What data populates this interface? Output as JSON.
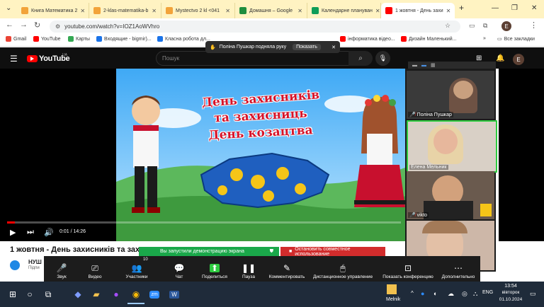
{
  "browser": {
    "tabs": [
      {
        "title": "Книга Математика 2",
        "color": "#f2a33a"
      },
      {
        "title": "2-klas-matematika-b",
        "color": "#f2a33a"
      },
      {
        "title": "Mystectvo 2 kl <041",
        "color": "#f2a33a"
      },
      {
        "title": "Домашня – Google",
        "color": "#1e8e3e"
      },
      {
        "title": "Календарне плануван",
        "color": "#0f9d58"
      },
      {
        "title": "1 жовтня - День захи",
        "color": "#ff0000",
        "active": true
      }
    ],
    "new_tab": "+",
    "url": "youtube.com/watch?v=IOZ1AoWVhro",
    "profile_initial": "E",
    "bookmarks": [
      {
        "label": "Gmail",
        "color": "#ea4335"
      },
      {
        "label": "YouTube",
        "color": "#ff0000"
      },
      {
        "label": "Карты",
        "color": "#34a853"
      },
      {
        "label": "Входящие - bigmir)...",
        "color": "#1a73e8"
      },
      {
        "label": "Класна робота дл...",
        "color": "#1a73e8"
      },
      {
        "label": "інформатика відео...",
        "color": "#ff0000"
      },
      {
        "label": "Дизайн Маленький...",
        "color": "#ff0000"
      }
    ],
    "all_bookmarks": "Все закладки"
  },
  "zoom_notice": {
    "text": "Поліна Пушкар подняла руку",
    "show_button": "Показать"
  },
  "youtube": {
    "logo": "YouTube",
    "region": "UA",
    "search_placeholder": "Пошук",
    "avatar_initial": "E",
    "video_title_short": "1 жовтня - День захисників та захисн",
    "channel_short": "НУШ",
    "subscribers_short": "Підпи",
    "time": "0:01 / 14:26",
    "progress": 0.02,
    "thumbnail_text": [
      "День захисників",
      "та захисниць",
      "День козацтва"
    ]
  },
  "zoom": {
    "participants": [
      {
        "name": "Поліна Пушкар",
        "muted": true,
        "hand": true
      },
      {
        "name": "Елена Мельник",
        "muted": false,
        "active": true
      },
      {
        "name": "vikto",
        "muted": true
      },
      {
        "name": "",
        "muted": false
      }
    ],
    "share_status": "Вы запустили демонстрацию экрана",
    "stop_share": "Остановить совместное использование",
    "toolbar": [
      {
        "label": "Звук",
        "icon": "mic-icon"
      },
      {
        "label": "Видео",
        "icon": "camera-icon"
      },
      {
        "label": "Участники",
        "icon": "participants-icon",
        "badge": "10"
      },
      {
        "label": "Чат",
        "icon": "chat-icon"
      },
      {
        "label": "Поделиться",
        "icon": "share-icon"
      },
      {
        "label": "Пауза",
        "icon": "pause-icon"
      },
      {
        "label": "Комментировать",
        "icon": "annotate-icon"
      },
      {
        "label": "Дистанционное управление",
        "icon": "remote-icon"
      },
      {
        "label": "Показать конференцию",
        "icon": "meeting-icon"
      },
      {
        "label": "Дополнительно",
        "icon": "more-icon"
      }
    ]
  },
  "taskbar": {
    "user": "Melnik",
    "lang": "ENG",
    "time": "13:54",
    "day": "вівторок",
    "date": "01.10.2024"
  }
}
